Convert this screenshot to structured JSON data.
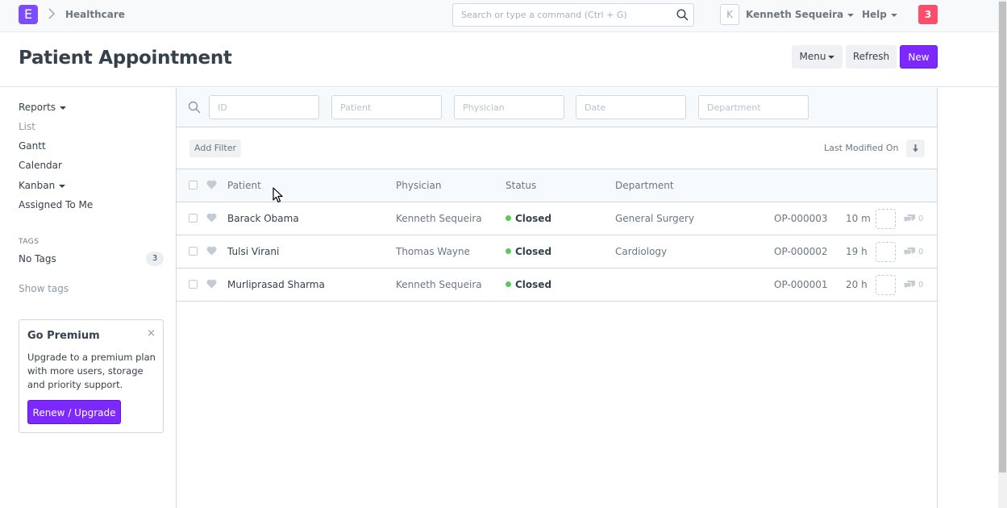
{
  "navbar": {
    "logo_letter": "E",
    "breadcrumb": "Healthcare",
    "search_placeholder": "Search or type a command (Ctrl + G)",
    "avatar_letter": "K",
    "user_name": "Kenneth Sequeira",
    "help_label": "Help",
    "notification_count": "3"
  },
  "page": {
    "title": "Patient Appointment",
    "menu_label": "Menu",
    "refresh_label": "Refresh",
    "new_label": "New"
  },
  "sidebar": {
    "items": [
      "Reports",
      "List",
      "Gantt",
      "Calendar",
      "Kanban",
      "Assigned To Me"
    ],
    "tags_heading": "TAGS",
    "no_tags_label": "No Tags",
    "no_tags_count": "3",
    "show_tags_label": "Show tags",
    "premium": {
      "title": "Go Premium",
      "close": "×",
      "text": "Upgrade to a premium plan with more users, storage and priority support.",
      "button": "Renew / Upgrade"
    }
  },
  "filters": {
    "placeholders": [
      "ID",
      "Patient",
      "Physician",
      "Date",
      "Department"
    ],
    "add_filter": "Add Filter",
    "sort_label": "Last Modified On"
  },
  "list": {
    "headers": {
      "patient": "Patient",
      "physician": "Physician",
      "status": "Status",
      "department": "Department"
    },
    "rows": [
      {
        "patient": "Barack Obama",
        "physician": "Kenneth Sequeira",
        "status": "Closed",
        "department": "General Surgery",
        "id": "OP-000003",
        "modified": "10 m",
        "comments": "0"
      },
      {
        "patient": "Tulsi Virani",
        "physician": "Thomas Wayne",
        "status": "Closed",
        "department": "Cardiology",
        "id": "OP-000002",
        "modified": "19 h",
        "comments": "0"
      },
      {
        "patient": "Murliprasad Sharma",
        "physician": "Kenneth Sequeira",
        "status": "Closed",
        "department": "",
        "id": "OP-000001",
        "modified": "20 h",
        "comments": "0"
      }
    ]
  },
  "colors": {
    "accent": "#7c28ff",
    "status_closed": "#5ac85a",
    "notification": "#ff4d6a"
  },
  "icons": [
    "logo-icon",
    "chevron-right-icon",
    "search-icon",
    "caret-down-icon",
    "heart-icon",
    "comment-icon",
    "sort-down-icon",
    "close-icon",
    "mouse-cursor-icon"
  ]
}
